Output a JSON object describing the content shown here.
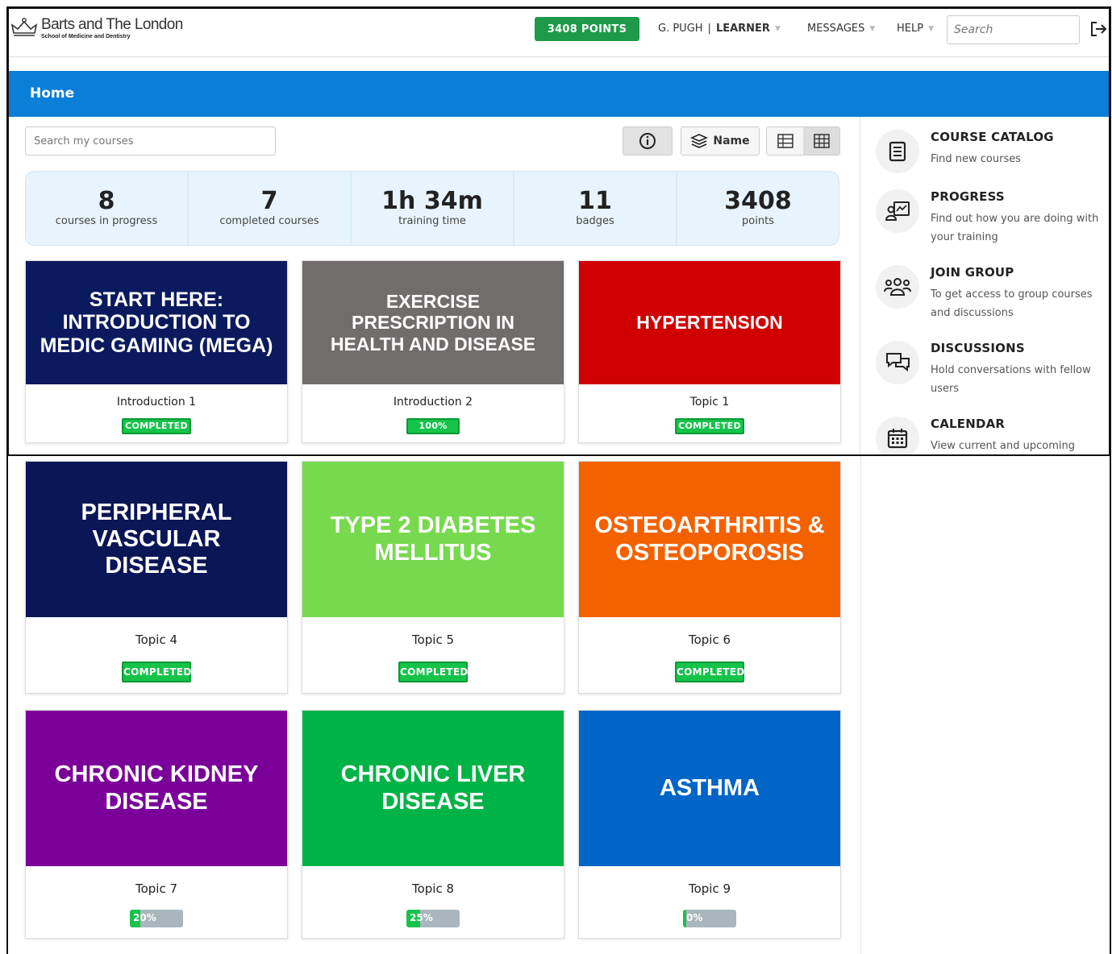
{
  "header": {
    "logo_name": "Barts and The London",
    "logo_sub": "School of Medicine and Dentistry",
    "points_label": "3408 POINTS",
    "user_name": "G. PUGH",
    "user_role": "LEARNER",
    "messages_label": "MESSAGES",
    "help_label": "HELP",
    "search_placeholder": "Search"
  },
  "page": {
    "title": "Home"
  },
  "toolbar": {
    "search_placeholder": "Search my courses",
    "sort_label": "Name"
  },
  "stats": [
    {
      "value": "8",
      "label": "courses in progress"
    },
    {
      "value": "7",
      "label": "completed courses"
    },
    {
      "value": "1h 34m",
      "label": "training time"
    },
    {
      "value": "11",
      "label": "badges"
    },
    {
      "value": "3408",
      "label": "points"
    }
  ],
  "courses": [
    {
      "title": "START HERE: INTRODUCTION TO MEDIC GAMING (MEGA)",
      "subtitle": "Introduction 1",
      "status": "COMPLETED",
      "color": "#0b1a5e"
    },
    {
      "title": "EXERCISE PRESCRIPTION IN HEALTH AND DISEASE",
      "subtitle": "Introduction 2",
      "status": "100%",
      "color": "#716d6c"
    },
    {
      "title": "HYPERTENSION",
      "subtitle": "Topic 1",
      "status": "COMPLETED",
      "color": "#d10000"
    },
    {
      "title": "PERIPHERAL VASCULAR DISEASE",
      "subtitle": "Topic 4",
      "status": "COMPLETED",
      "color": "#0a1656"
    },
    {
      "title": "TYPE 2 DIABETES MELLITUS",
      "subtitle": "Topic 5",
      "status": "COMPLETED",
      "color": "#77d94e"
    },
    {
      "title": "OSTEOARTHRITIS & OSTEOPOROSIS",
      "subtitle": "Topic 6",
      "status": "COMPLETED",
      "color": "#f46200"
    },
    {
      "title": "CHRONIC KIDNEY DISEASE",
      "subtitle": "Topic 7",
      "progress_label": "20%",
      "progress": 0.2,
      "color": "#7a0099"
    },
    {
      "title": "CHRONIC LIVER DISEASE",
      "subtitle": "Topic 8",
      "progress_label": "25%",
      "progress": 0.25,
      "color": "#00b346"
    },
    {
      "title": "ASTHMA",
      "subtitle": "Topic 9",
      "progress_label": "0%",
      "progress": 0.0,
      "color": "#0065c6"
    }
  ],
  "sidebar": [
    {
      "title": "COURSE CATALOG",
      "desc": "Find new courses",
      "icon": "catalog-icon"
    },
    {
      "title": "PROGRESS",
      "desc": "Find out how you are doing with your training",
      "icon": "progress-icon"
    },
    {
      "title": "JOIN GROUP",
      "desc": "To get access to group courses and discussions",
      "icon": "group-icon"
    },
    {
      "title": "DISCUSSIONS",
      "desc": "Hold conversations with fellow users",
      "icon": "discussions-icon"
    },
    {
      "title": "CALENDAR",
      "desc": "View current and upcoming",
      "icon": "calendar-icon"
    }
  ]
}
